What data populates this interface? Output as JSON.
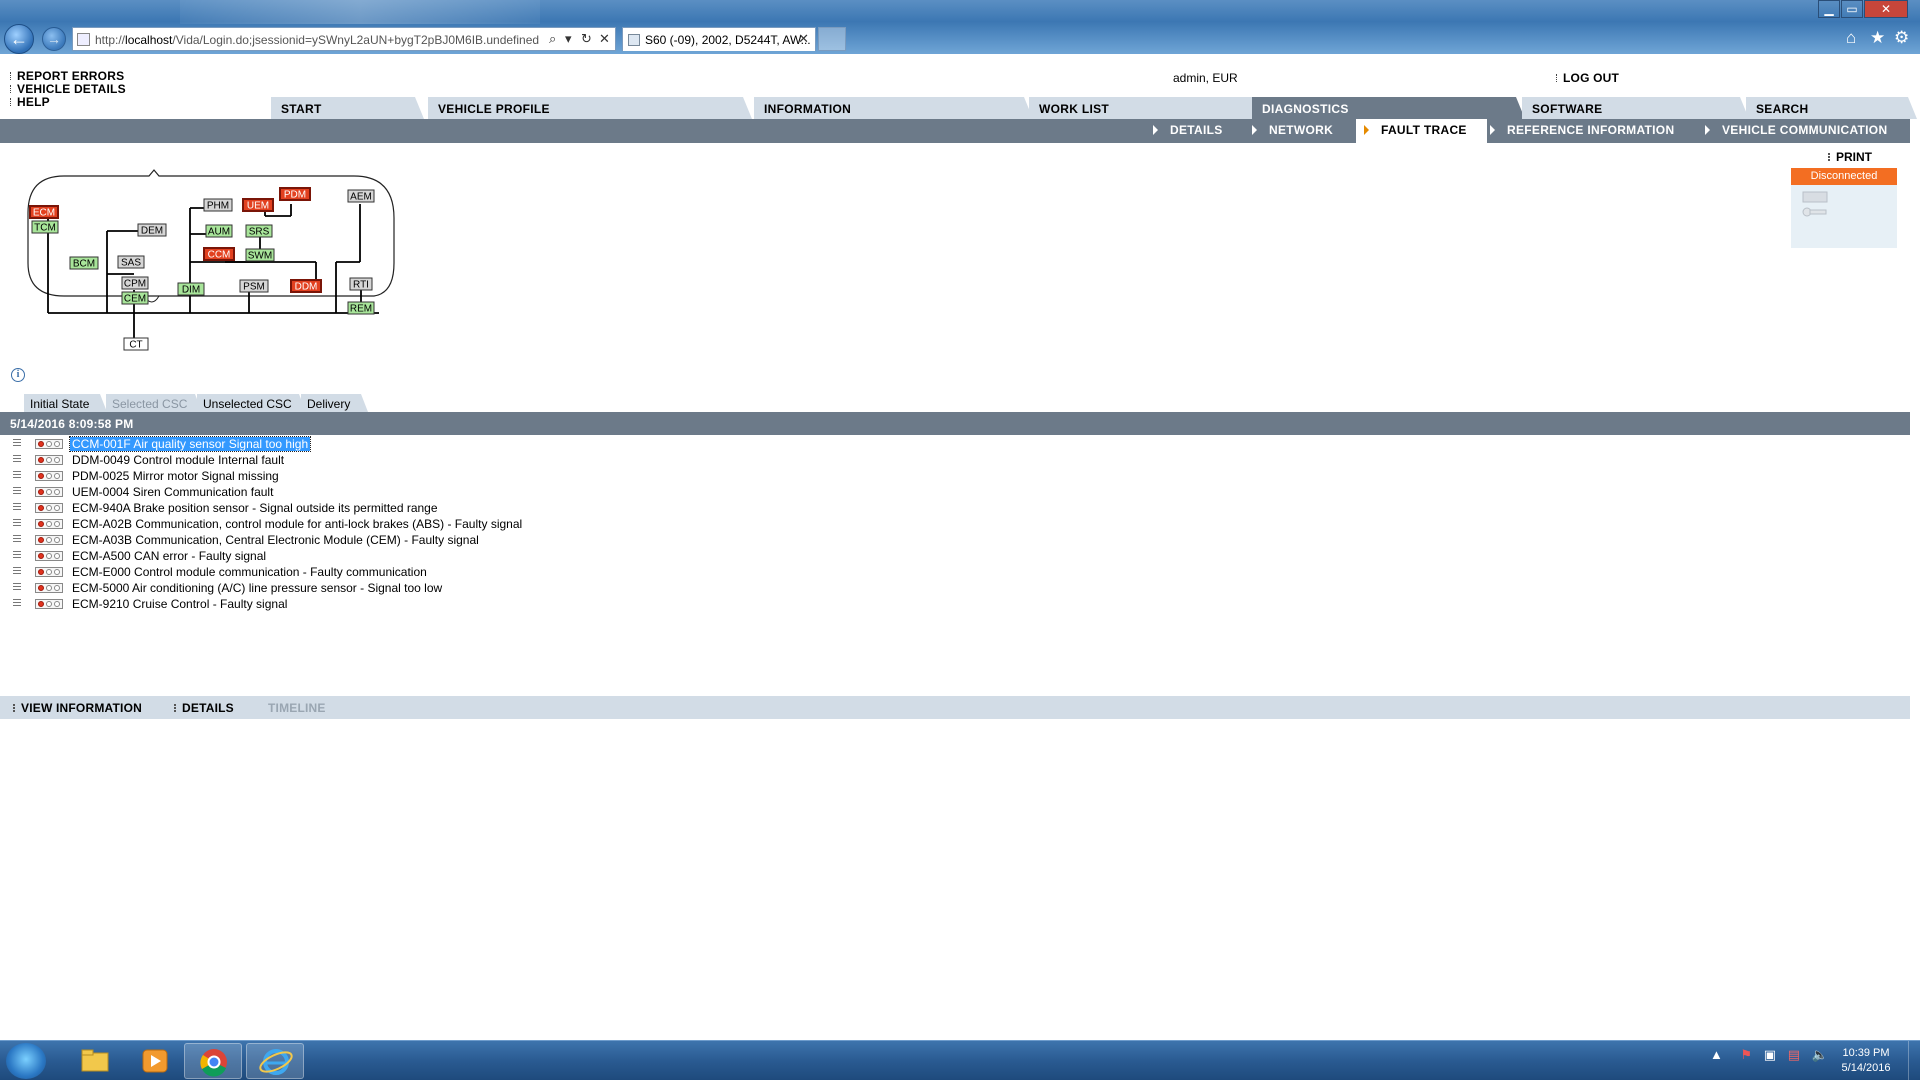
{
  "browser": {
    "url_prefix": "http://",
    "url_host": "localhost",
    "url_rest": "/Vida/Login.do;jsessionid=ySWnyL2aUN+bygT2pBJ0M6IB.undefined",
    "tab_title": "S60 (-09), 2002, D5244T, AW...",
    "tab_close": "✕",
    "search_glyph": "⌕",
    "refresh_glyph": "↻",
    "stop_glyph": "✕",
    "back_glyph": "←",
    "forward_glyph": "→",
    "home_glyph": "⌂",
    "favorites_glyph": "★",
    "tools_glyph": "⚙",
    "min_glyph": "▁",
    "max_glyph": "▭",
    "close_glyph": "✕"
  },
  "header": {
    "links": [
      "REPORT ERRORS",
      "VEHICLE DETAILS",
      "HELP"
    ],
    "user": "admin, EUR",
    "logout": "LOG OUT"
  },
  "main_tabs": [
    "START",
    "VEHICLE PROFILE",
    "INFORMATION",
    "WORK LIST",
    "DIAGNOSTICS",
    "SOFTWARE",
    "SEARCH"
  ],
  "active_main_tab": "DIAGNOSTICS",
  "sub_tabs": [
    "DETAILS",
    "NETWORK",
    "FAULT TRACE",
    "REFERENCE INFORMATION",
    "VEHICLE COMMUNICATION"
  ],
  "active_sub_tab": "FAULT TRACE",
  "print": "PRINT",
  "connection": {
    "status": "Disconnected",
    "status_color": "#f36e22"
  },
  "diagram": {
    "modules": [
      {
        "name": "ECM",
        "state": "fault"
      },
      {
        "name": "TCM",
        "state": "ok"
      },
      {
        "name": "DEM",
        "state": "neutral"
      },
      {
        "name": "BCM",
        "state": "ok"
      },
      {
        "name": "SAS",
        "state": "neutral"
      },
      {
        "name": "CPM",
        "state": "neutral"
      },
      {
        "name": "CEM",
        "state": "ok"
      },
      {
        "name": "CT",
        "state": "plain"
      },
      {
        "name": "PHM",
        "state": "neutral"
      },
      {
        "name": "UEM",
        "state": "fault"
      },
      {
        "name": "PDM",
        "state": "fault"
      },
      {
        "name": "AUM",
        "state": "ok"
      },
      {
        "name": "SRS",
        "state": "ok"
      },
      {
        "name": "CCM",
        "state": "fault"
      },
      {
        "name": "SWM",
        "state": "ok"
      },
      {
        "name": "DIM",
        "state": "ok"
      },
      {
        "name": "PSM",
        "state": "neutral"
      },
      {
        "name": "DDM",
        "state": "fault"
      },
      {
        "name": "AEM",
        "state": "neutral"
      },
      {
        "name": "RTI",
        "state": "neutral"
      },
      {
        "name": "REM",
        "state": "ok"
      }
    ],
    "colors": {
      "fault": "#e2401f",
      "ok": "#a8e59a",
      "neutral": "#d6d6d6",
      "plain": "#ffffff"
    }
  },
  "state_tabs": [
    {
      "label": "Initial State",
      "enabled": true
    },
    {
      "label": "Selected CSC",
      "enabled": false
    },
    {
      "label": "Unselected CSC",
      "enabled": true
    },
    {
      "label": "Delivery",
      "enabled": true
    }
  ],
  "timestamp": "5/14/2016 8:09:58 PM",
  "faults": [
    "CCM-001F Air quality sensor Signal too high",
    "DDM-0049 Control module Internal fault",
    "PDM-0025 Mirror motor Signal missing",
    "UEM-0004 Siren Communication fault",
    "ECM-940A Brake position sensor - Signal outside its permitted range",
    "ECM-A02B Communication, control module for anti-lock brakes (ABS) - Faulty signal",
    "ECM-A03B Communication, Central Electronic Module (CEM) - Faulty signal",
    "ECM-A500 CAN error - Faulty signal",
    "ECM-E000 Control module communication - Faulty communication",
    "ECM-5000 Air conditioning (A/C) line pressure sensor - Signal too low",
    "ECM-9210 Cruise Control - Faulty signal"
  ],
  "selected_fault": 0,
  "bottom_actions": [
    {
      "label": "VIEW INFORMATION",
      "enabled": true
    },
    {
      "label": "DETAILS",
      "enabled": true
    },
    {
      "label": "TIMELINE",
      "enabled": false
    }
  ],
  "taskbar": {
    "time": "10:39 PM",
    "date": "5/14/2016"
  }
}
